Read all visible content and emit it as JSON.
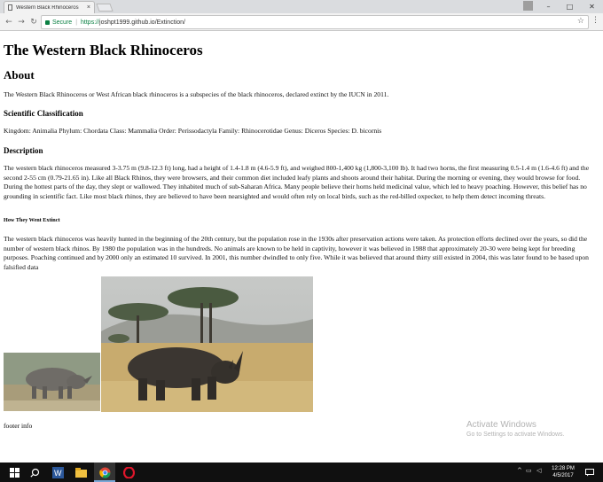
{
  "browser": {
    "tab_title": "Western Black Rhinoceros",
    "tab_close": "×",
    "secure_label": "Secure",
    "url_proto": "https://",
    "url_rest": "joshpt1999.github.io/Extinction/",
    "window_minimize": "–",
    "window_maximize": "□",
    "window_close": "✕",
    "star": "☆",
    "menu": "⋮",
    "nav_back": "←",
    "nav_forward": "→",
    "nav_reload": "↻"
  },
  "page": {
    "title": "The Western Black Rhinoceros",
    "about_heading": "About",
    "about_text": "The Western Black Rhinoceros or West African black rhinoceros is a subspecies of the black rhinoceros, declared extinct by the IUCN in 2011.",
    "classification_heading": "Scientific Classification",
    "classification_text": "Kingdom: Animalia Phylum: Chordata Class: Mammalia Order: Perissodactyla Family: Rhinocerotidae Genus: Diceros Species: D. bicornis",
    "description_heading": "Description",
    "description_text": "The western black rhinoceros measured 3-3.75 m (9.8-12.3 ft) long, had a height of 1.4-1.8 m (4.6-5.9 ft), and weighed 800-1,400 kg (1,800-3,100 lb). It had two horns, the first measuring 0.5-1.4 m (1.6-4.6 ft) and the second 2-55 cm (0.79-21.65 in). Like all Black Rhinos, they were browsers, and their common diet included leafy plants and shoots around their habitat. During the morning or evening, they would browse for food. During the hottest parts of the day, they slept or wallowed. They inhabited much of sub-Saharan Africa. Many people believe their horns held medicinal value, which led to heavy poaching. However, this belief has no grounding in scientific fact. Like most black rhinos, they are believed to have been nearsighted and would often rely on local birds, such as the red-billed oxpecker, to help them detect incoming threats.",
    "extinct_heading": "How They Went Extinct",
    "extinct_text": "The western black rhinoceros was heavily hunted in the beginning of the 20th century, but the population rose in the 1930s after preservation actions were taken. As protection efforts declined over the years, so did the number of western black rhinos. By 1980 the population was in the hundreds. No animals are known to be held in captivity, however it was believed in 1988 that approximately 20-30 were being kept for breeding purposes. Poaching continued and by 2000 only an estimated 10 survived. In 2001, this number dwindled to only five. While it was believed that around thirty still existed in 2004, this was later found to be based upon falsified data",
    "footer": "footer info"
  },
  "watermark": {
    "line1": "Activate Windows",
    "line2": "Go to Settings to activate Windows."
  },
  "taskbar": {
    "time": "12:28 PM",
    "date": "4/5/2017"
  },
  "colors": {
    "secure_green": "#0b8043",
    "taskbar": "#101010",
    "chrome_frame": "#dadcdf"
  }
}
